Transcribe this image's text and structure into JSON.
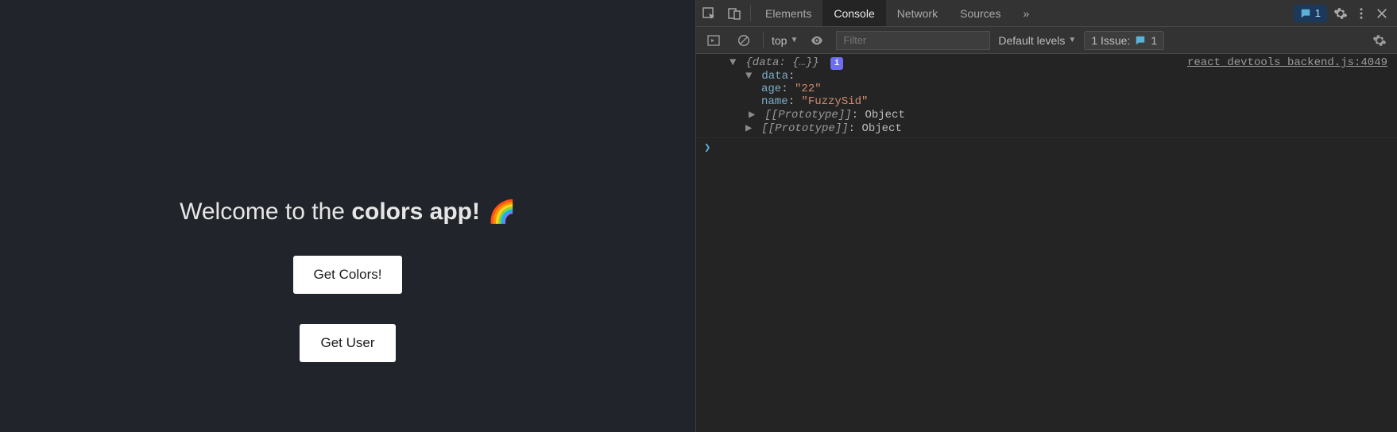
{
  "app": {
    "heading_prefix": "Welcome to the ",
    "heading_bold": "colors app!",
    "rainbow": "🌈",
    "get_colors_btn": "Get Colors!",
    "get_user_btn": "Get User"
  },
  "devtools": {
    "tabs": {
      "elements": "Elements",
      "console": "Console",
      "network": "Network",
      "sources": "Sources",
      "more": "»"
    },
    "message_count": "1",
    "toolbar": {
      "context": "top",
      "filter_placeholder": "Filter",
      "levels_label": "Default levels",
      "issues_label": "1 Issue:",
      "issues_count": "1"
    },
    "console": {
      "source_link": "react_devtools_backend.js:4049",
      "root_summary": "{data: {…}}",
      "expanded": {
        "data_key": "data",
        "props": [
          {
            "key": "age",
            "value": "\"22\""
          },
          {
            "key": "name",
            "value": "\"FuzzySid\""
          }
        ],
        "proto_label": "[[Prototype]]",
        "proto_value": "Object"
      }
    }
  }
}
